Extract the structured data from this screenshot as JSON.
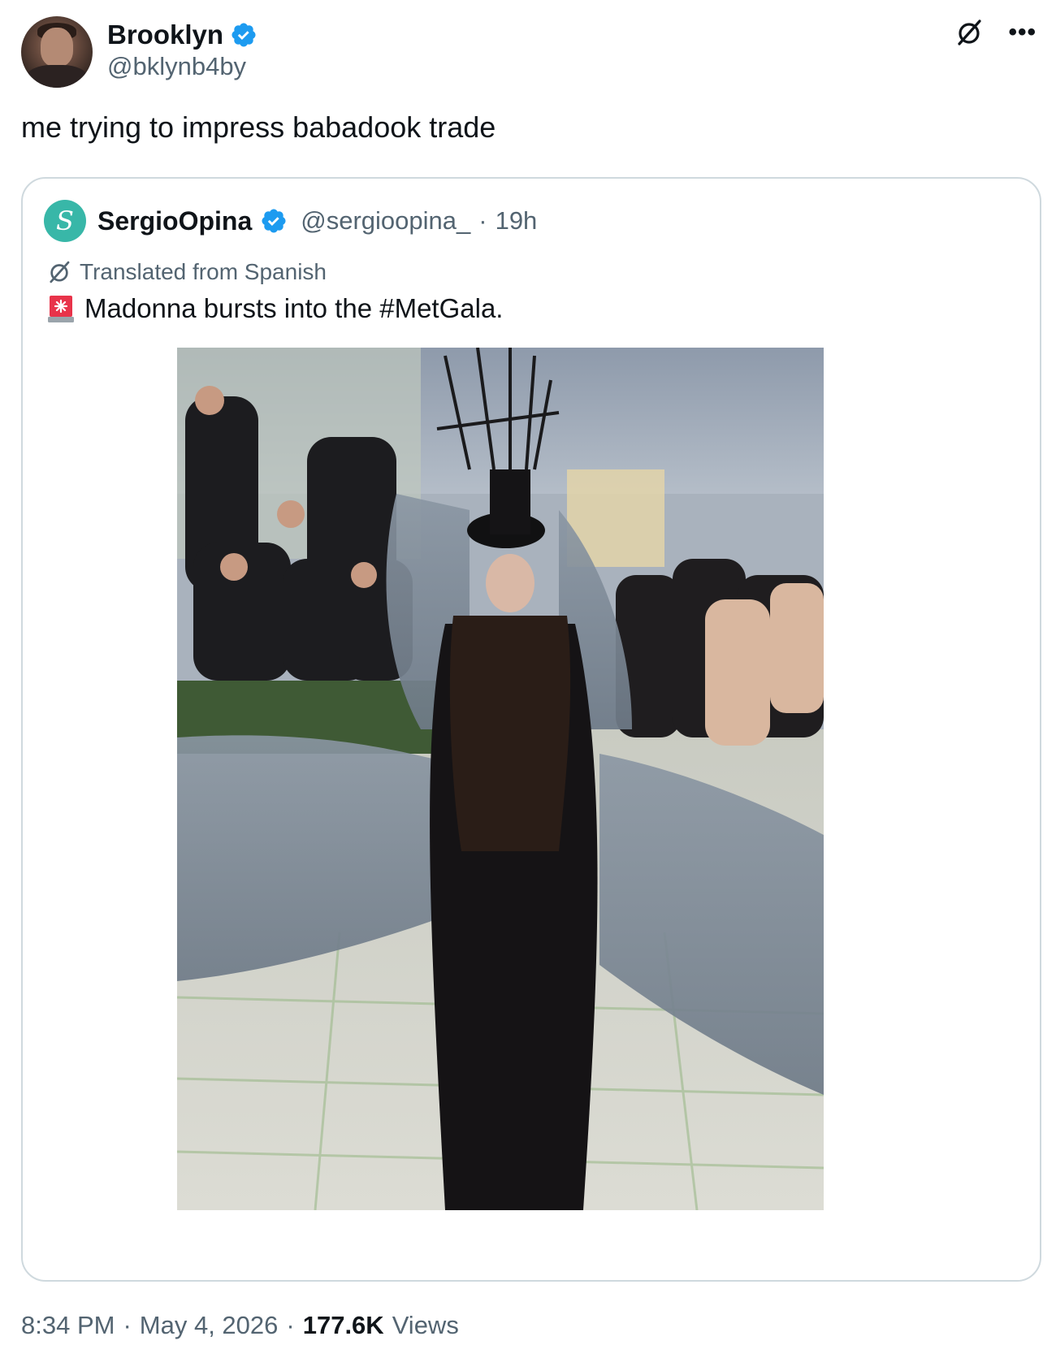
{
  "author": {
    "display_name": "Brooklyn",
    "handle": "@bklynb4by",
    "verified": true
  },
  "icons": {
    "grok": "slashed-circle-icon",
    "more": "more-dots-icon",
    "verified": "verified-badge-icon",
    "translate": "slashed-circle-icon",
    "siren": "siren-emoji-icon"
  },
  "tweet": {
    "text": "me trying to impress babadook trade",
    "time": "8:34 PM",
    "date": "May 4, 2026",
    "views_count": "177.6K",
    "views_label": "Views",
    "sep": "·"
  },
  "quoted": {
    "display_name": "SergioOpina",
    "handle": "@sergioopina_",
    "sep": "·",
    "age": "19h",
    "avatar_letter": "S",
    "translated_label": "Translated from Spanish",
    "text": "Madonna bursts into the #MetGala."
  },
  "colors": {
    "verified_blue": "#1d9bf0",
    "secondary_text": "#536471",
    "border": "#cfd9de",
    "quoted_avatar": "#38b7a8"
  }
}
